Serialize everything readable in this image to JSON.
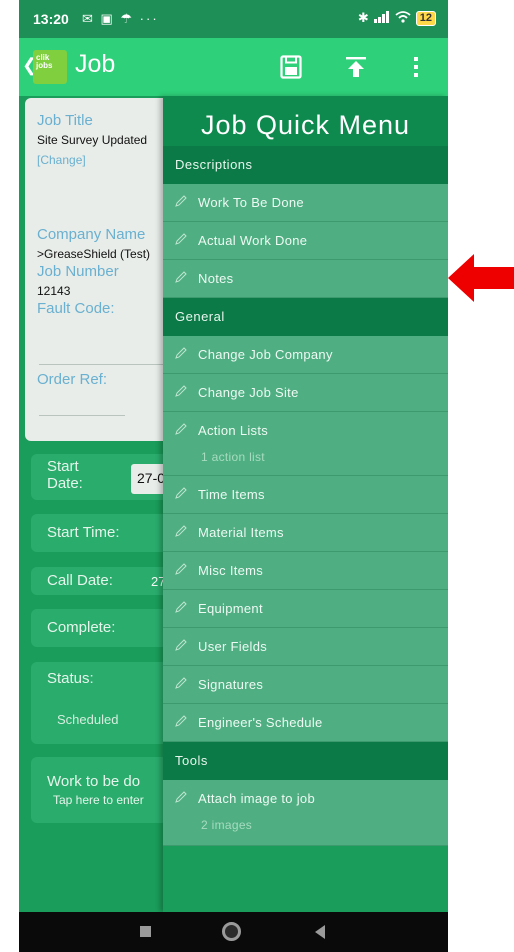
{
  "statusbar": {
    "time": "13:20",
    "left_icons": "✉ ▣ ☂ ···",
    "battery": "12"
  },
  "appbar": {
    "logo_text": "clik jobs",
    "title": "Job",
    "save_icon": "save-icon",
    "upload_icon": "upload-icon",
    "more_icon": "more-vertical-icon"
  },
  "job": {
    "job_title_label": "Job Title",
    "job_title_value": "Site Survey Updated",
    "change_link": "[Change]",
    "company_label": "Company Name",
    "company_value": ">GreaseShield (Test)",
    "job_number_label": "Job Number",
    "job_number_value": "12143",
    "fault_code_label": "Fault Code:",
    "order_ref_label": "Order Ref:",
    "start_date_label": "Start Date:",
    "start_date_value": "27-0",
    "start_time_label": "Start Time:",
    "call_date_label": "Call Date:",
    "call_date_value": "27",
    "complete_label": "Complete:",
    "status_label": "Status:",
    "status_value": "Scheduled",
    "work_label": "Work to be do",
    "work_hint": "Tap here to enter"
  },
  "menu": {
    "title": "Job Quick Menu",
    "sections": [
      {
        "label": "Descriptions"
      },
      {
        "label": "General"
      },
      {
        "label": "Tools"
      }
    ],
    "items": [
      {
        "label": "Work To Be Done",
        "sub": ""
      },
      {
        "label": "Actual Work Done",
        "sub": ""
      },
      {
        "label": "Notes",
        "sub": ""
      },
      {
        "label": "Change Job Company",
        "sub": ""
      },
      {
        "label": "Change Job Site",
        "sub": ""
      },
      {
        "label": "Action Lists",
        "sub": "1 action list"
      },
      {
        "label": "Time Items",
        "sub": ""
      },
      {
        "label": "Material Items",
        "sub": ""
      },
      {
        "label": "Misc Items",
        "sub": ""
      },
      {
        "label": "Equipment",
        "sub": ""
      },
      {
        "label": "User Fields",
        "sub": ""
      },
      {
        "label": "Signatures",
        "sub": ""
      },
      {
        "label": "Engineer's Schedule",
        "sub": ""
      },
      {
        "label": "Attach image to job",
        "sub": "2 images"
      }
    ]
  },
  "colors": {
    "accent": "#2ed17a",
    "menu_item": "#4fae82",
    "section": "#0b7a47",
    "arrow": "#ee0000"
  }
}
